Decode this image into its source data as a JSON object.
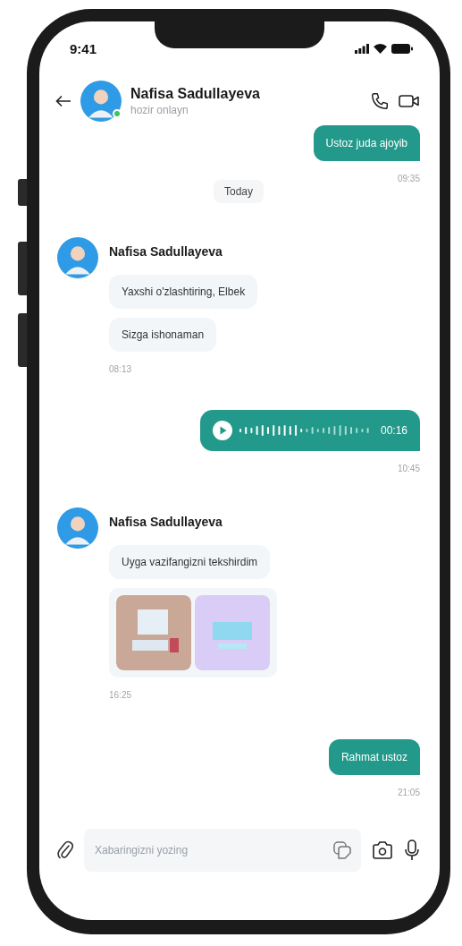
{
  "status_bar": {
    "time": "9:41"
  },
  "header": {
    "name": "Nafisa Sadullayeva",
    "status": "hozir onlayn",
    "online": true
  },
  "messages": [
    {
      "kind": "outgoing_text",
      "text": "Ustoz juda ajoyib",
      "time": "09:35"
    },
    {
      "kind": "day",
      "label": "Today"
    },
    {
      "kind": "incoming",
      "sender": "Nafisa Sadullayeva",
      "items": [
        {
          "kind": "text",
          "text": "Yaxshi o'zlashtiring, Elbek"
        },
        {
          "kind": "text",
          "text": "Sizga ishonaman"
        }
      ],
      "time": "08:13"
    },
    {
      "kind": "outgoing_voice",
      "duration": "00:16",
      "time": "10:45"
    },
    {
      "kind": "incoming",
      "sender": "Nafisa Sadullayeva",
      "items": [
        {
          "kind": "text",
          "text": "Uyga vazifangizni tekshirdim"
        },
        {
          "kind": "images"
        }
      ],
      "time": "16:25"
    },
    {
      "kind": "outgoing_text",
      "text": "Rahmat ustoz",
      "time": "21:05"
    }
  ],
  "composer": {
    "placeholder": "Xabaringizni yozing"
  }
}
